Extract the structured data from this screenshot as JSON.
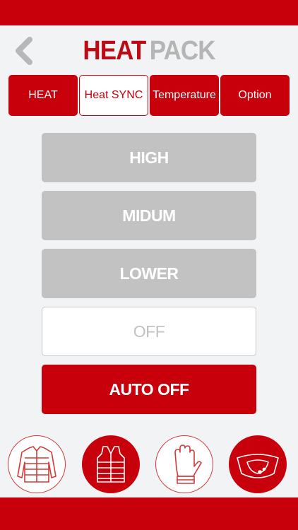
{
  "header": {
    "title_part1": "HEAT",
    "title_part2": "PACK"
  },
  "tabs": [
    {
      "label": "HEAT",
      "active": false
    },
    {
      "label": "Heat SYNC",
      "active": true
    },
    {
      "label": "Temperature",
      "active": false
    },
    {
      "label": "Option",
      "active": false
    }
  ],
  "levels": {
    "high": "HIGH",
    "medium": "MIDUM",
    "lower": "LOWER",
    "off": "OFF",
    "auto_off": "AUTO OFF"
  },
  "products": [
    {
      "icon": "jacket-icon",
      "selected": false
    },
    {
      "icon": "vest-icon",
      "selected": true
    },
    {
      "icon": "glove-icon",
      "selected": false
    },
    {
      "icon": "neck-warmer-icon",
      "selected": true
    }
  ],
  "colors": {
    "accent": "#c8000c",
    "inactive": "#c2c2c2",
    "background": "#f2f3f4"
  }
}
